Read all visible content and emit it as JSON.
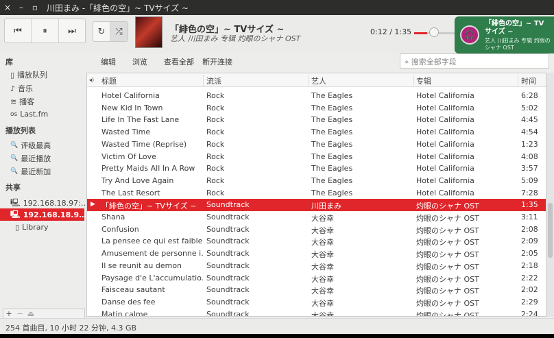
{
  "window": {
    "title": "川田まみ -「緋色の空」~ TVサイズ ~",
    "close": "×",
    "minimize": "–",
    "maximize": "▫"
  },
  "player": {
    "prev": "⏮",
    "pause": "⏸",
    "next": "⏭",
    "repeat": "↻",
    "shuffle": "⤮",
    "now_title": "「緋色の空」~ TVサイズ ~",
    "now_sub": "艺人 川田まみ 专辑 灼眼のシャナ OST",
    "time": "0:12 / 1:35",
    "progress": 0.126
  },
  "notification": {
    "title": "「緋色の空」~ TVサイズ ~",
    "sub": "艺人 川田まみ 专辑 灼眼のシャナ OST",
    "icon": "headphones-icon"
  },
  "sidebar": {
    "library_header": "库",
    "library": [
      {
        "label": "播放队列",
        "icon": "▯"
      },
      {
        "label": "音乐",
        "icon": "♪"
      },
      {
        "label": "播客",
        "icon": "≋"
      },
      {
        "label": "Last.fm",
        "icon": "os"
      }
    ],
    "playlists_header": "播放列表",
    "playlists": [
      {
        "label": "评级最高",
        "icon": "🔍"
      },
      {
        "label": "最近播放",
        "icon": "🔍"
      },
      {
        "label": "最近新加",
        "icon": "🔍"
      }
    ],
    "shared_header": "共享",
    "shared": [
      {
        "label": "192.168.18.97:…",
        "icon": "🖳"
      },
      {
        "label": "192.168.18.9…",
        "icon": "🖳"
      }
    ],
    "library_sub": "Library",
    "add": "+",
    "remove": "−",
    "eject": "⏏"
  },
  "content_toolbar": {
    "items": [
      "编辑",
      "浏览",
      "查看全部",
      "断开连接"
    ],
    "search_placeholder": "搜索全部字段"
  },
  "table": {
    "columns": [
      "标题",
      "流派",
      "艺人",
      "专辑",
      "时间"
    ],
    "rows": [
      [
        "Hotel California",
        "Rock",
        "The Eagles",
        "Hotel California",
        "6:28"
      ],
      [
        "New Kid In Town",
        "Rock",
        "The Eagles",
        "Hotel California",
        "5:02"
      ],
      [
        "Life In The Fast Lane",
        "Rock",
        "The Eagles",
        "Hotel California",
        "4:45"
      ],
      [
        "Wasted Time",
        "Rock",
        "The Eagles",
        "Hotel California",
        "4:54"
      ],
      [
        "Wasted Time (Reprise)",
        "Rock",
        "The Eagles",
        "Hotel California",
        "1:23"
      ],
      [
        "Victim Of Love",
        "Rock",
        "The Eagles",
        "Hotel California",
        "4:08"
      ],
      [
        "Pretty Maids All In A Row",
        "Rock",
        "The Eagles",
        "Hotel California",
        "3:57"
      ],
      [
        "Try And Love Again",
        "Rock",
        "The Eagles",
        "Hotel California",
        "5:09"
      ],
      [
        "The Last Resort",
        "Rock",
        "The Eagles",
        "Hotel California",
        "7:28"
      ],
      [
        "「緋色の空」~ TVサイズ ~",
        "Soundtrack",
        "川田まみ",
        "灼眼のシャナ OST",
        "1:35"
      ],
      [
        "Shana",
        "Soundtrack",
        "大谷幸",
        "灼眼のシャナ OST",
        "3:11"
      ],
      [
        "Confusion",
        "Soundtrack",
        "大谷幸",
        "灼眼のシャナ OST",
        "2:08"
      ],
      [
        "La pensee ce qui est faible",
        "Soundtrack",
        "大谷幸",
        "灼眼のシャナ OST",
        "2:09"
      ],
      [
        "Amusement de personne i…",
        "Soundtrack",
        "大谷幸",
        "灼眼のシャナ OST",
        "2:05"
      ],
      [
        "Il se reunit au demon",
        "Soundtrack",
        "大谷幸",
        "灼眼のシャナ OST",
        "2:18"
      ],
      [
        "Paysage d'e L'accumulatio…",
        "Soundtrack",
        "大谷幸",
        "灼眼のシャナ OST",
        "2:22"
      ],
      [
        "Faisceau sautant",
        "Soundtrack",
        "大谷幸",
        "灼眼のシャナ OST",
        "2:02"
      ],
      [
        "Danse des fee",
        "Soundtrack",
        "大谷幸",
        "灼眼のシャナ OST",
        "2:29"
      ],
      [
        "Matin calme",
        "Soundtrack",
        "大谷幸",
        "灼眼のシャナ OST",
        "2:24"
      ]
    ],
    "playing_index": 9
  },
  "status": "254 首曲目, 10 小时 22 分钟, 4.3 GB",
  "colors": {
    "accent": "#e0262b",
    "notification": "#2e7d4b"
  }
}
